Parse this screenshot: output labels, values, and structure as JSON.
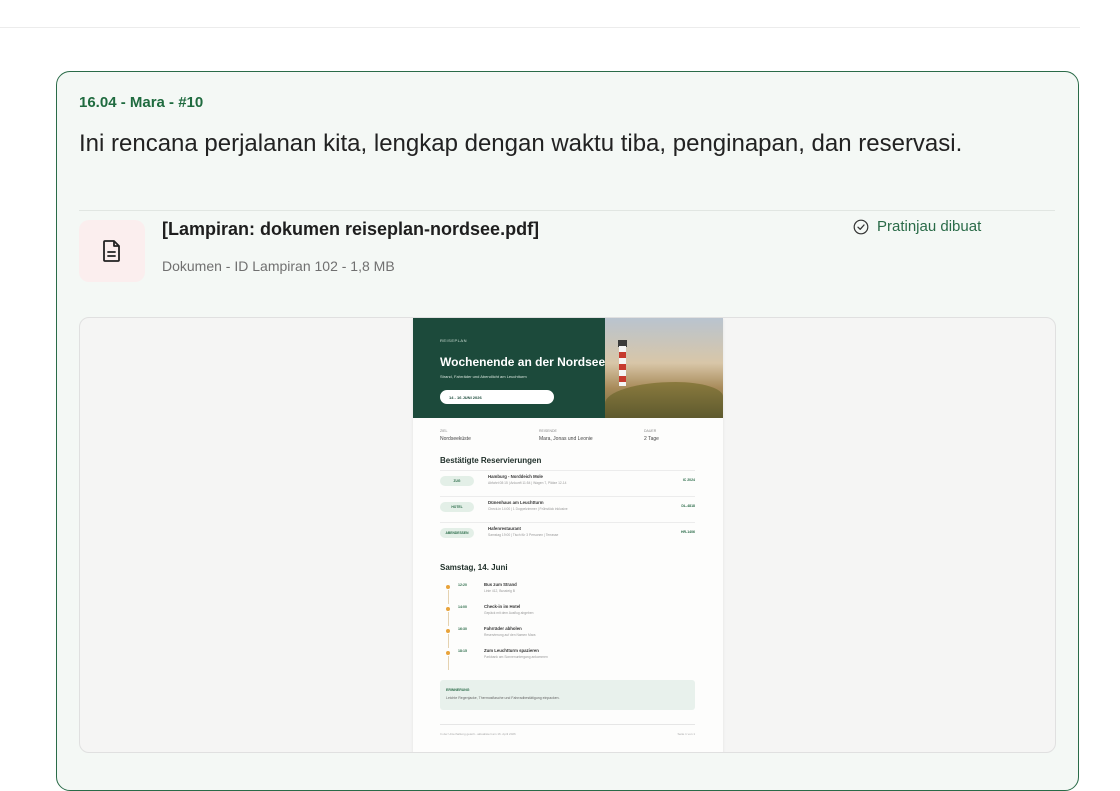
{
  "message": {
    "meta": "16.04 - Mara - #10",
    "text": "Ini rencana perjalanan kita, lengkap dengan waktu tiba, penginapan, dan reservasi."
  },
  "attachment": {
    "icon": "document-icon",
    "title": "[Lampiran: dokumen reiseplan-nordsee.pdf]",
    "subtitle": "Dokumen - ID Lampiran 102 - 1,8 MB",
    "status_icon": "check-circle-icon",
    "status": "Pratinjau dibuat"
  },
  "colors": {
    "accent": "#2a6b48",
    "card_bg": "#f4f8f5",
    "hero": "#1c4a3b",
    "attachment_icon_bg": "#fbeeee"
  },
  "document": {
    "tag": "REISEPLAN",
    "title": "Wochenende an der Nordsee",
    "subtitle": "Strand, Fahrräder und Abendlicht am Leuchtturm",
    "date_pill": "14 - 16 JUNI 2026",
    "facts": [
      {
        "label": "ZIEL",
        "value": "Nordseeküste"
      },
      {
        "label": "REISENDE",
        "value": "Mara, Jonas und Leonie"
      },
      {
        "label": "DAUER",
        "value": "2 Tage"
      }
    ],
    "reservations_heading": "Bestätigte Reservierungen",
    "reservations": [
      {
        "badge": "ZUG",
        "title": "Hamburg - Norddeich Mole",
        "detail": "Abfahrt 08:15 | Ankunft 11:54 | Wagen 7, Plätze 12-14",
        "code": "IC 2024"
      },
      {
        "badge": "HOTEL",
        "title": "Dünenhaus am Leuchtturm",
        "detail": "Check-in 14:00 | 1 Doppelzimmer | Frühstück inklusive",
        "code": "DL-4818"
      },
      {
        "badge": "ABENDESSEN",
        "title": "Hafenrestaurant",
        "detail": "Samstag 19:00 | Tisch für 3 Personen | Terrasse",
        "code": "HR-1406"
      }
    ],
    "day_heading": "Samstag, 14. Juni",
    "timeline": [
      {
        "time": "12:20",
        "title": "Bus zum Strand",
        "detail": "Linie 412, Bussteig B"
      },
      {
        "time": "14:00",
        "title": "Check-in im Hotel",
        "detail": "Gepäck mit dem Ausflug abgeben"
      },
      {
        "time": "16:30",
        "title": "Fahrräder abholen",
        "detail": "Reservierung auf den Namen Mara"
      },
      {
        "time": "18:15",
        "title": "Zum Leuchtturm spazieren",
        "detail": "Parkbank am Sonnenuntergang ankommen"
      }
    ],
    "reminder_title": "ERINNERUNG",
    "reminder_text": "Leichte Regenjacke, Thermosflasche und Fahrradbestätigung einpacken.",
    "footer_left": "In der Unterhaltung geteilt - aktualisiert am 16. April 2026",
    "footer_right": "Seite 1 von 1"
  }
}
